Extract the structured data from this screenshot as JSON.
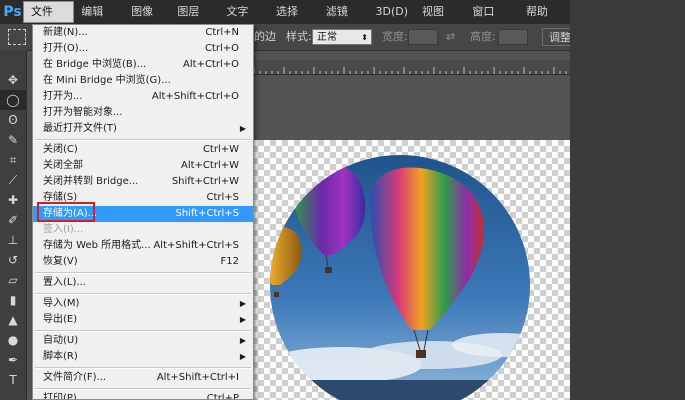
{
  "app": {
    "logo": "Ps"
  },
  "menubar": {
    "items": [
      "文件(F)",
      "编辑(E)",
      "图像(I)",
      "图层(L)",
      "文字(Y)",
      "选择(S)",
      "滤镜(T)",
      "3D(D)",
      "视图(V)",
      "窗口(W)",
      "帮助(H)"
    ],
    "active_index": 0
  },
  "options": {
    "trail_text": "的边",
    "style_label": "样式:",
    "style_value": "正常",
    "width_label": "宽度:",
    "height_label": "高度:",
    "adjust_button": "调整"
  },
  "file_menu": {
    "items": [
      {
        "label": "新建(N)...",
        "shortcut": "Ctrl+N"
      },
      {
        "label": "打开(O)...",
        "shortcut": "Ctrl+O"
      },
      {
        "label": "在 Bridge 中浏览(B)...",
        "shortcut": "Alt+Ctrl+O"
      },
      {
        "label": "在 Mini Bridge 中浏览(G)...",
        "shortcut": ""
      },
      {
        "label": "打开为...",
        "shortcut": "Alt+Shift+Ctrl+O"
      },
      {
        "label": "打开为智能对象...",
        "shortcut": ""
      },
      {
        "label": "最近打开文件(T)",
        "shortcut": "",
        "submenu": true
      },
      {
        "separator": true
      },
      {
        "label": "关闭(C)",
        "shortcut": "Ctrl+W"
      },
      {
        "label": "关闭全部",
        "shortcut": "Alt+Ctrl+W"
      },
      {
        "label": "关闭并转到 Bridge...",
        "shortcut": "Shift+Ctrl+W"
      },
      {
        "label": "存储(S)",
        "shortcut": "Ctrl+S"
      },
      {
        "label": "存储为(A)...",
        "shortcut": "Shift+Ctrl+S",
        "highlighted": true
      },
      {
        "label": "签入(I)...",
        "shortcut": "",
        "disabled": true
      },
      {
        "label": "存储为 Web 所用格式...",
        "shortcut": "Alt+Shift+Ctrl+S"
      },
      {
        "label": "恢复(V)",
        "shortcut": "F12"
      },
      {
        "separator": true
      },
      {
        "label": "置入(L)...",
        "shortcut": ""
      },
      {
        "separator": true
      },
      {
        "label": "导入(M)",
        "shortcut": "",
        "submenu": true
      },
      {
        "label": "导出(E)",
        "shortcut": "",
        "submenu": true
      },
      {
        "separator": true
      },
      {
        "label": "自动(U)",
        "shortcut": "",
        "submenu": true
      },
      {
        "label": "脚本(R)",
        "shortcut": "",
        "submenu": true
      },
      {
        "separator": true
      },
      {
        "label": "文件简介(F)...",
        "shortcut": "Alt+Shift+Ctrl+I"
      },
      {
        "separator": true
      },
      {
        "label": "打印(P)...",
        "shortcut": "Ctrl+P"
      }
    ]
  },
  "icons": {
    "tools": [
      "move-icon",
      "marquee-icon",
      "lasso-icon",
      "quick-select-icon",
      "crop-icon",
      "eyedropper-icon",
      "healing-brush-icon",
      "brush-icon",
      "clone-stamp-icon",
      "history-brush-icon",
      "eraser-icon",
      "gradient-icon",
      "blur-icon",
      "dodge-icon",
      "pen-icon",
      "type-icon"
    ],
    "submenu": "chevron-right-icon"
  },
  "colors": {
    "highlight": "#3399ff",
    "annotation": "#d52020",
    "menubar": "#2b2b2b",
    "sky": "#1e4f86"
  }
}
